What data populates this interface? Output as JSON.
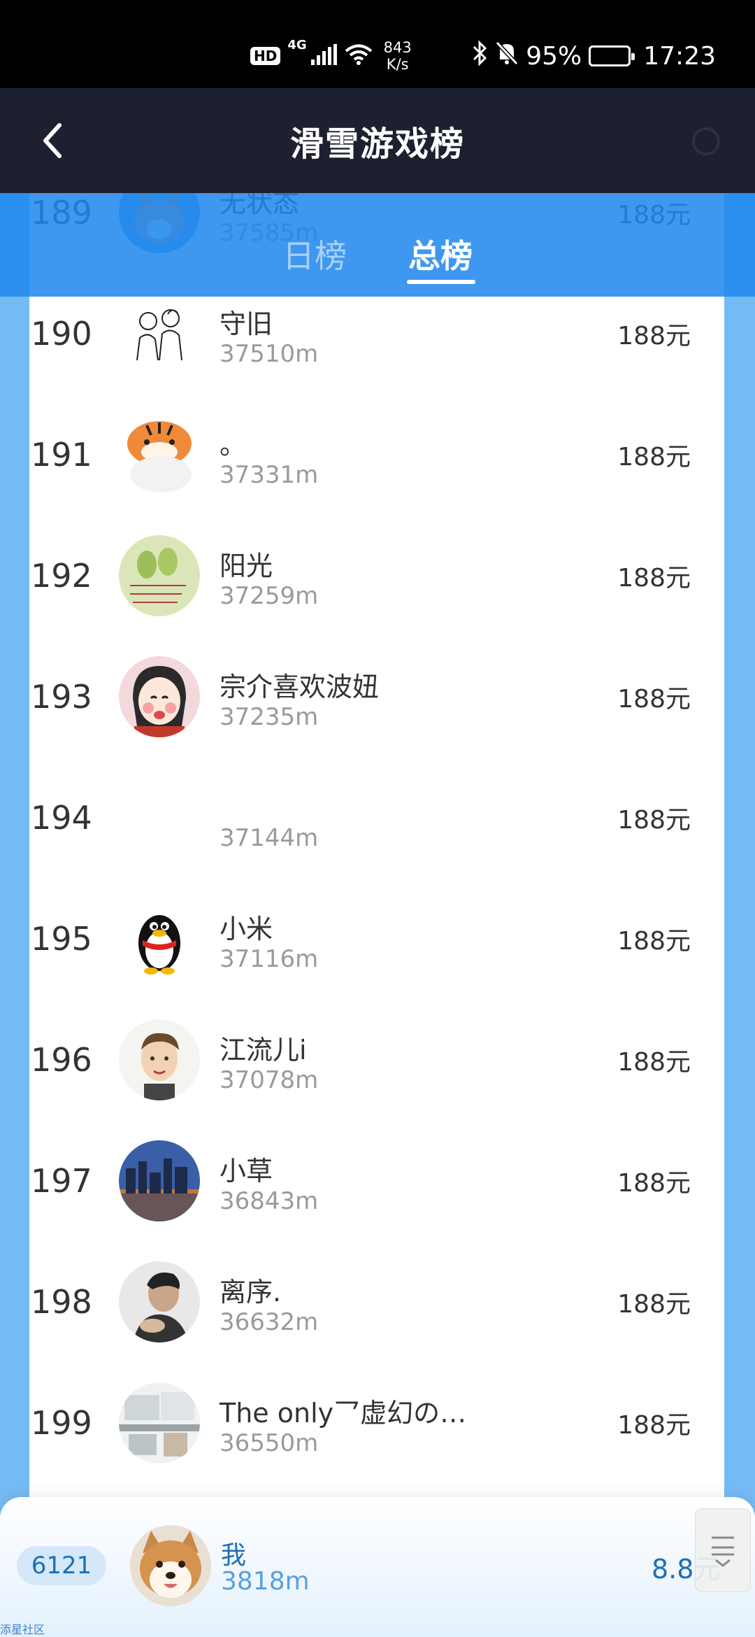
{
  "status_bar": {
    "hd": "HD",
    "network": "4G",
    "speed_value": "843",
    "speed_unit": "K/s",
    "battery": "95%",
    "time": "17:23"
  },
  "header": {
    "title": "滑雪游戏榜"
  },
  "tabs": [
    {
      "label": "日榜",
      "active": false
    },
    {
      "label": "总榜",
      "active": true
    }
  ],
  "leaderboard": [
    {
      "rank": "189",
      "name": "无状态",
      "distance": "37585m",
      "prize": "188元",
      "avatar": "dog-avatar"
    },
    {
      "rank": "190",
      "name": "守旧",
      "distance": "37510m",
      "prize": "188元",
      "avatar": "sketch-couple-avatar"
    },
    {
      "rank": "191",
      "name": "。",
      "distance": "37331m",
      "prize": "188元",
      "avatar": "tiger-avatar"
    },
    {
      "rank": "192",
      "name": "阳光",
      "distance": "37259m",
      "prize": "188元",
      "avatar": "pear-note-avatar"
    },
    {
      "rank": "193",
      "name": "宗介喜欢波妞",
      "distance": "37235m",
      "prize": "188元",
      "avatar": "cartoon-girl-avatar"
    },
    {
      "rank": "194",
      "name": "",
      "distance": "37144m",
      "prize": "188元",
      "avatar": ""
    },
    {
      "rank": "195",
      "name": "小米",
      "distance": "37116m",
      "prize": "188元",
      "avatar": "penguin-avatar"
    },
    {
      "rank": "196",
      "name": "江流儿i",
      "distance": "37078m",
      "prize": "188元",
      "avatar": "cartoon-man-avatar"
    },
    {
      "rank": "197",
      "name": "小草",
      "distance": "36843m",
      "prize": "188元",
      "avatar": "city-night-avatar"
    },
    {
      "rank": "198",
      "name": "离序.",
      "distance": "36632m",
      "prize": "188元",
      "avatar": "person-photo-avatar"
    },
    {
      "rank": "199",
      "name": "The only乛虚幻の…",
      "distance": "36550m",
      "prize": "188元",
      "avatar": "kitchen-photo-avatar"
    }
  ],
  "me": {
    "rank": "6121",
    "name": "我",
    "distance": "3818m",
    "prize": "8.8元",
    "avatar": "shiba-dog-avatar"
  },
  "watermark": "添星社区"
}
